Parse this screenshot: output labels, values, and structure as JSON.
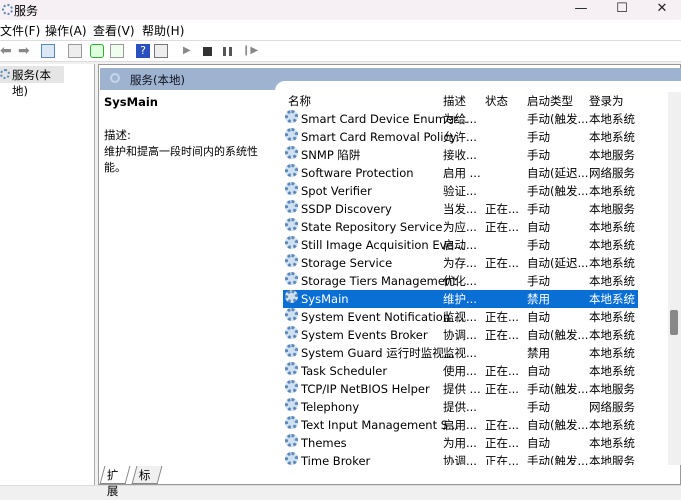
{
  "window": {
    "title": "服务",
    "icon": "gear-icon",
    "controls": [
      "—",
      "☐",
      "✕"
    ]
  },
  "menu": [
    "文件(F)",
    "操作(A)",
    "查看(V)",
    "帮助(H)"
  ],
  "toolbar": [
    "back-icon",
    "forward-icon",
    "show-tree-icon",
    "properties-icon",
    "refresh-icon",
    "export-icon",
    "help-icon",
    "console-icon",
    "start-icon",
    "stop-icon",
    "pause-icon",
    "resume-icon"
  ],
  "tree": {
    "root": "服务(本地)"
  },
  "panel": {
    "header": "服务(本地)",
    "selected_name": "SysMain",
    "desc_label": "描述:",
    "desc_text": "维护和提高一段时间内的系统性能。"
  },
  "columns": [
    "名称",
    "描述",
    "状态",
    "启动类型",
    "登录为"
  ],
  "rows": [
    [
      "Smart Card Device Enumer...",
      "为给...",
      "",
      "手动(触发...",
      "本地系统"
    ],
    [
      "Smart Card Removal Policy",
      "允许...",
      "",
      "手动",
      "本地系统"
    ],
    [
      "SNMP 陷阱",
      "接收...",
      "",
      "手动",
      "本地服务"
    ],
    [
      "Software Protection",
      "启用 ...",
      "",
      "自动(延迟...",
      "网络服务"
    ],
    [
      "Spot Verifier",
      "验证...",
      "",
      "手动(触发...",
      "本地系统"
    ],
    [
      "SSDP Discovery",
      "当发...",
      "正在...",
      "手动",
      "本地服务"
    ],
    [
      "State Repository Service",
      "为应...",
      "正在...",
      "自动",
      "本地系统"
    ],
    [
      "Still Image Acquisition Eve...",
      "启动...",
      "",
      "手动",
      "本地系统"
    ],
    [
      "Storage Service",
      "为存...",
      "正在...",
      "自动(延迟...",
      "本地系统"
    ],
    [
      "Storage Tiers Management",
      "优化...",
      "",
      "手动",
      "本地系统"
    ],
    [
      "SysMain",
      "维护...",
      "",
      "禁用",
      "本地系统"
    ],
    [
      "System Event Notification ...",
      "监视...",
      "正在...",
      "自动",
      "本地系统"
    ],
    [
      "System Events Broker",
      "协调...",
      "正在...",
      "自动(触发...",
      "本地系统"
    ],
    [
      "System Guard 运行时监视...",
      "监视...",
      "",
      "禁用",
      "本地系统"
    ],
    [
      "Task Scheduler",
      "使用...",
      "正在...",
      "自动",
      "本地系统"
    ],
    [
      "TCP/IP NetBIOS Helper",
      "提供 ...",
      "正在...",
      "手动(触发...",
      "本地服务"
    ],
    [
      "Telephony",
      "提供...",
      "",
      "手动",
      "网络服务"
    ],
    [
      "Text Input Management S...",
      "启用...",
      "正在...",
      "自动(触发...",
      "本地系统"
    ],
    [
      "Themes",
      "为用...",
      "正在...",
      "自动",
      "本地系统"
    ],
    [
      "Time Broker",
      "协调...",
      "正在...",
      "手动(触发...",
      "本地服务"
    ]
  ],
  "selected_index": 10,
  "tabs": [
    "扩展",
    "标准"
  ],
  "colors": {
    "selection": "#0a6fd4",
    "header": "#9db3cf"
  }
}
